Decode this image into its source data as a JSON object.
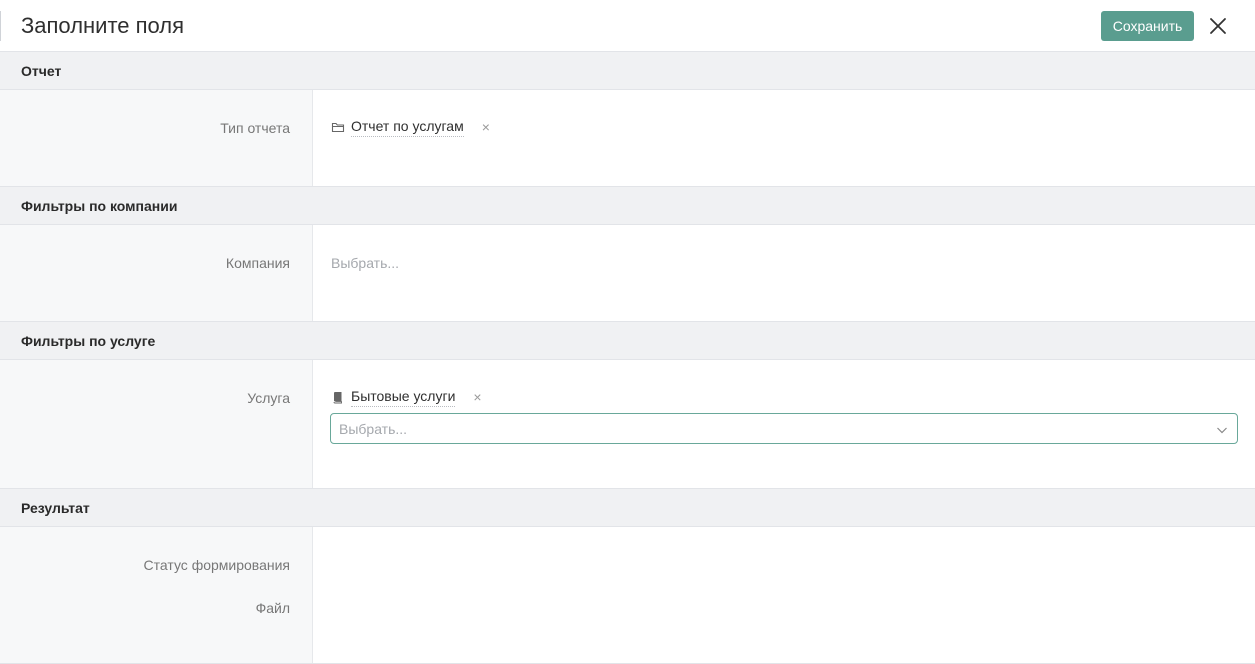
{
  "header": {
    "title": "Заполните поля",
    "save_label": "Сохранить",
    "close_icon": "close-icon"
  },
  "sections": {
    "report": {
      "title": "Отчет",
      "field_label": "Тип отчета",
      "value": "Отчет по услугам",
      "value_icon": "folder-icon",
      "remove_glyph": "×"
    },
    "company": {
      "title": "Фильтры по компании",
      "field_label": "Компания",
      "placeholder": "Выбрать..."
    },
    "service": {
      "title": "Фильтры по услуге",
      "field_label": "Услуга",
      "value": "Бытовые услуги",
      "value_icon": "book-icon",
      "remove_glyph": "×",
      "select_placeholder": "Выбрать..."
    },
    "result": {
      "title": "Результат",
      "status_label": "Статус формирования",
      "file_label": "Файл"
    }
  },
  "colors": {
    "accent": "#5a9d8f",
    "select_border": "#69a89a",
    "section_bg": "#f0f1f3"
  }
}
